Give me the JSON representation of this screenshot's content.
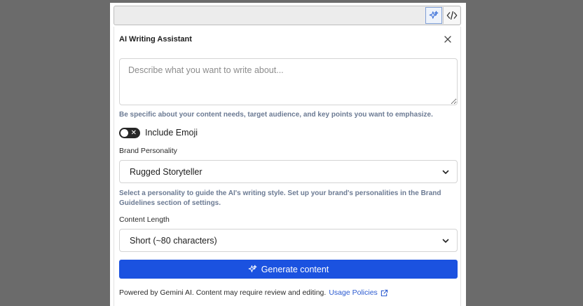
{
  "panel": {
    "title": "AI Writing Assistant",
    "prompt": {
      "placeholder": "Describe what you want to write about...",
      "value": ""
    },
    "prompt_hint": "Be specific about your content needs, target audience, and key points you want to emphasize.",
    "emoji_toggle": {
      "label": "Include Emoji",
      "on": false
    },
    "brand_personality": {
      "label": "Brand Personality",
      "selected": "Rugged Storyteller",
      "hint": "Select a personality to guide the AI's writing style. Set up your brand's personalities in the Brand Guidelines section of settings."
    },
    "content_length": {
      "label": "Content Length",
      "selected": "Short (~80 characters)"
    },
    "generate_label": "Generate content",
    "footer": {
      "text": "Powered by Gemini AI. Content may require review and editing.",
      "link_label": "Usage Policies"
    }
  },
  "icons": {
    "ai": "sparkle-icon",
    "code": "code-icon",
    "close": "close-icon",
    "chevron": "chevron-down-icon",
    "external": "external-link-icon"
  },
  "colors": {
    "accent": "#1b52e0",
    "hint_text": "#6b7a93",
    "link": "#2a5ad0",
    "toggle_off": "#262626"
  }
}
